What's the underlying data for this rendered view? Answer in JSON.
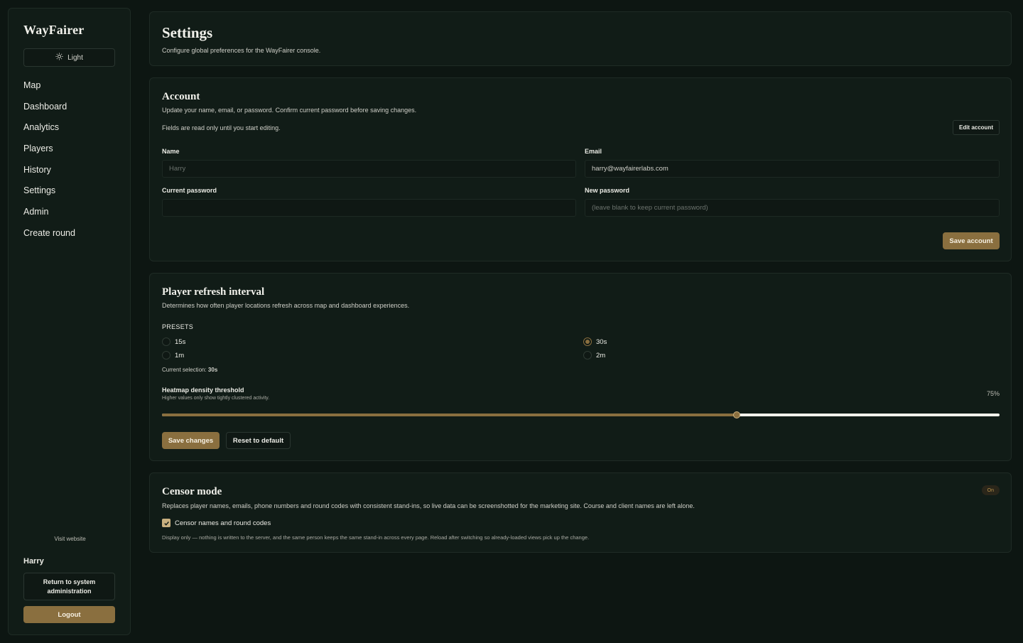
{
  "sidebar": {
    "brand": "WayFairer",
    "theme_label": "Light",
    "nav": [
      {
        "label": "Map"
      },
      {
        "label": "Dashboard"
      },
      {
        "label": "Analytics"
      },
      {
        "label": "Players"
      },
      {
        "label": "History"
      },
      {
        "label": "Settings"
      },
      {
        "label": "Admin"
      },
      {
        "label": "Create round"
      }
    ],
    "visit_website": "Visit website",
    "user_name": "Harry",
    "return_label": "Return to system administration",
    "logout_label": "Logout"
  },
  "header": {
    "title": "Settings",
    "subtitle": "Configure global preferences for the WayFairer console."
  },
  "account": {
    "title": "Account",
    "description": "Update your name, email, or password. Confirm current password before saving changes.",
    "note": "Fields are read only until you start editing.",
    "edit_label": "Edit account",
    "name_label": "Name",
    "name_value": "Harry",
    "email_label": "Email",
    "email_value": "harry@wayfairerlabs.com",
    "current_password_label": "Current password",
    "new_password_label": "New password",
    "new_password_placeholder": "(leave blank to keep current password)",
    "save_label": "Save account"
  },
  "refresh": {
    "title": "Player refresh interval",
    "description": "Determines how often player locations refresh across map and dashboard experiences.",
    "presets_label": "PRESETS",
    "presets": [
      {
        "label": "15s",
        "selected": false
      },
      {
        "label": "30s",
        "selected": true
      },
      {
        "label": "1m",
        "selected": false
      },
      {
        "label": "2m",
        "selected": false
      }
    ],
    "current_prefix": "Current selection: ",
    "current_value": "30s",
    "heatmap_label": "Heatmap density threshold",
    "heatmap_help": "Higher values only show tightly clustered activity.",
    "heatmap_value": "75%",
    "heatmap_fraction": 0.686,
    "save_label": "Save changes",
    "reset_label": "Reset to default"
  },
  "censor": {
    "title": "Censor mode",
    "badge": "On",
    "description": "Replaces player names, emails, phone numbers and round codes with consistent stand-ins, so live data can be screenshotted for the marketing site. Course and client names are left alone.",
    "checkbox_label": "Censor names and round codes",
    "checked": true,
    "note": "Display only — nothing is written to the server, and the same person keeps the same stand-in across every page. Reload after switching so already-loaded views pick up the change."
  }
}
